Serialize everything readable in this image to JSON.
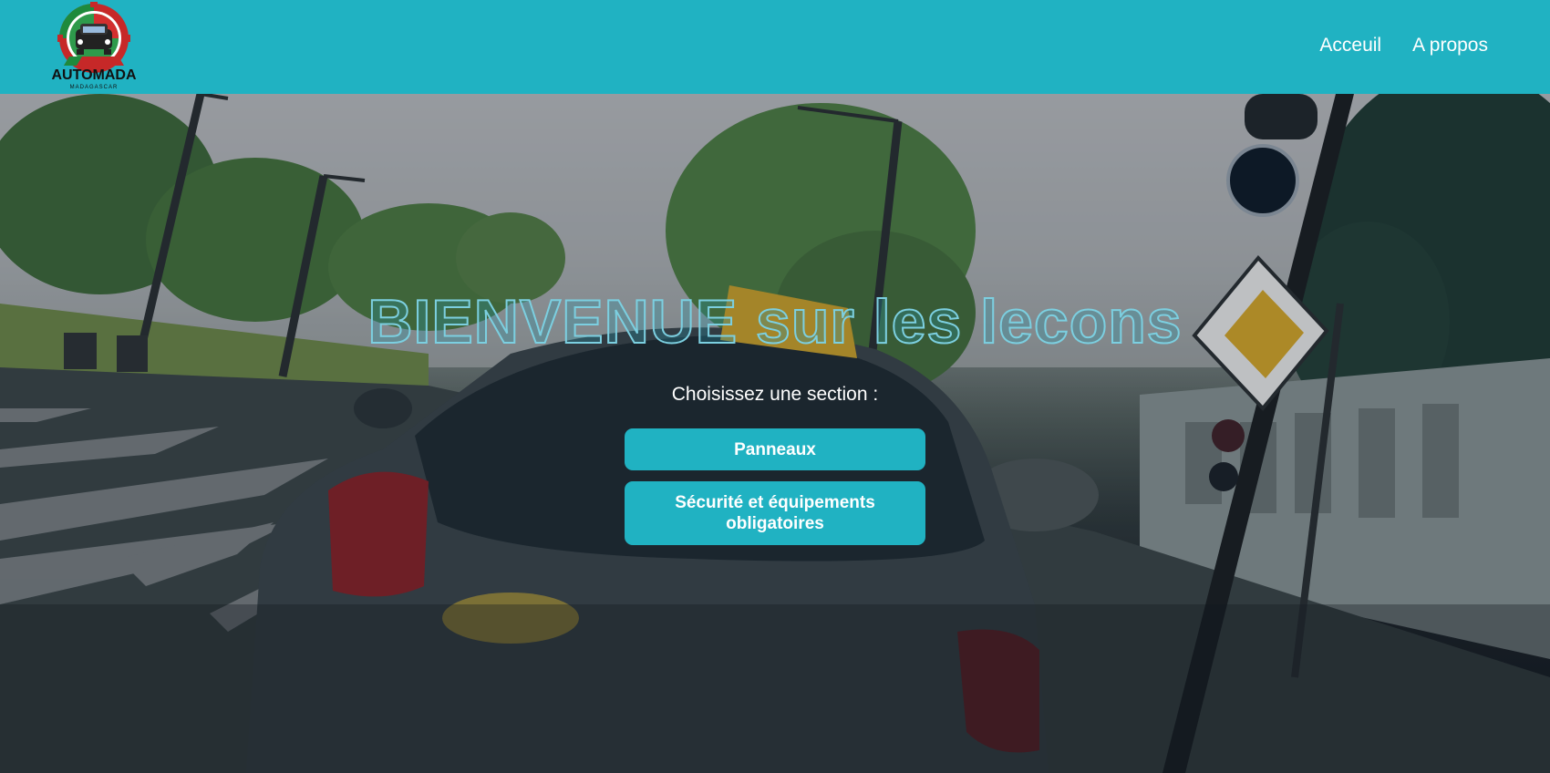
{
  "header": {
    "logo": {
      "icon": "car-badge-icon",
      "title": "AUTOMADA",
      "subtitle": "MADAGASCAR"
    },
    "nav": [
      {
        "label": "Acceuil"
      },
      {
        "label": "A propos"
      }
    ]
  },
  "hero": {
    "title": "BIENVENUE sur les lecons",
    "subtitle": "Choisissez une section :",
    "buttons": [
      {
        "label": "Panneaux"
      },
      {
        "label": "Sécurité et équipements obligatoires"
      }
    ],
    "background": "driving-school-car-photo"
  },
  "colors": {
    "accent": "#20b2c2",
    "title_stroke": "#7ccfe0",
    "text": "#ffffff"
  }
}
